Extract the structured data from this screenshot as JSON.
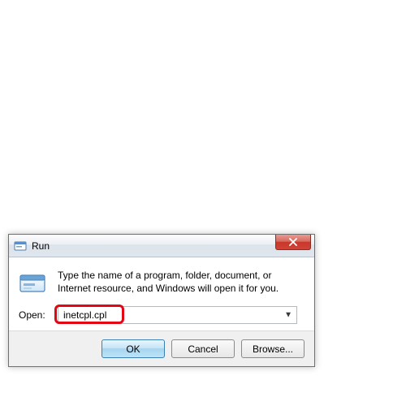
{
  "dialog": {
    "title": "Run",
    "description": "Type the name of a program, folder, document, or Internet resource, and Windows will open it for you.",
    "open_label": "Open:",
    "input_value": "inetcpl.cpl",
    "buttons": {
      "ok": "OK",
      "cancel": "Cancel",
      "browse": "Browse..."
    }
  }
}
